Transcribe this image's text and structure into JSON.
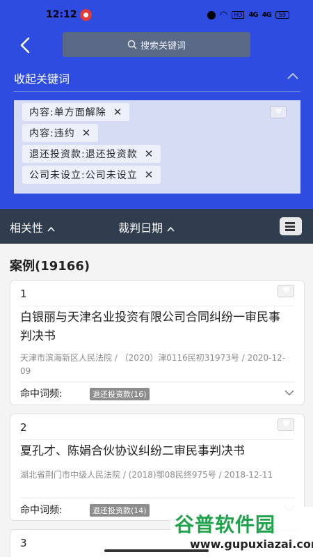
{
  "status": {
    "time": "12:12",
    "hd": "HD",
    "signal1": "4G",
    "signal2": "4G",
    "battery": "59"
  },
  "search": {
    "placeholder": "搜索关键词"
  },
  "keywords": {
    "header": "收起关键词",
    "tags": [
      {
        "label": "内容:单方面解除"
      },
      {
        "label": "内容:违约"
      },
      {
        "label": "退还投资款:退还投资款"
      },
      {
        "label": "公司未设立:公司未设立"
      }
    ]
  },
  "sort": {
    "relevance": "相关性",
    "date": "裁判日期"
  },
  "cases": {
    "count_label": "案例(19166)",
    "hit_label": "命中词频:",
    "items": [
      {
        "num": "1",
        "title": "白银丽与天津名业投资有限公司合同纠纷一审民事判决书",
        "meta": "天津市滨海新区人民法院 / （2020）津0116民初31973号 / 2020-12-09",
        "hit": "退还投资款(16)"
      },
      {
        "num": "2",
        "title": "夏孔才、陈娟合伙协议纠纷二审民事判决书",
        "meta": "湖北省荆门市中级人民法院 / (2018)鄂08民终975号 / 2018-12-11",
        "hit": "退还投资款(14)"
      },
      {
        "num": "3"
      }
    ]
  },
  "watermark": {
    "title": "谷普软件园",
    "url": "www.gupuxiazai.com"
  }
}
